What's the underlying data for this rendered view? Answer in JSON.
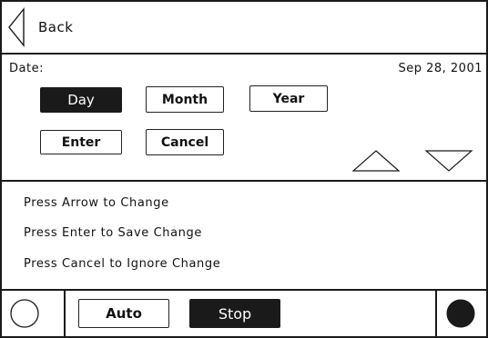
{
  "header": {
    "back_label": "Back",
    "back_icon": "chevron-left-icon"
  },
  "date_panel": {
    "date_label": "Date:",
    "date_value": "Sep 28, 2001",
    "unit_buttons": [
      {
        "label": "Day",
        "selected": true
      },
      {
        "label": "Month",
        "selected": false
      },
      {
        "label": "Year",
        "selected": false
      }
    ],
    "enter_label": "Enter",
    "cancel_label": "Cancel",
    "up_icon": "arrow-up-icon",
    "down_icon": "arrow-down-icon"
  },
  "instructions": [
    "Press Arrow to Change",
    "Press Enter to Save Change",
    "Press Cancel to Ignore Change"
  ],
  "footer": {
    "left_indicator_icon": "circle-outline-icon",
    "auto_label": "Auto",
    "stop_label": "Stop",
    "right_indicator_icon": "circle-filled-icon"
  }
}
